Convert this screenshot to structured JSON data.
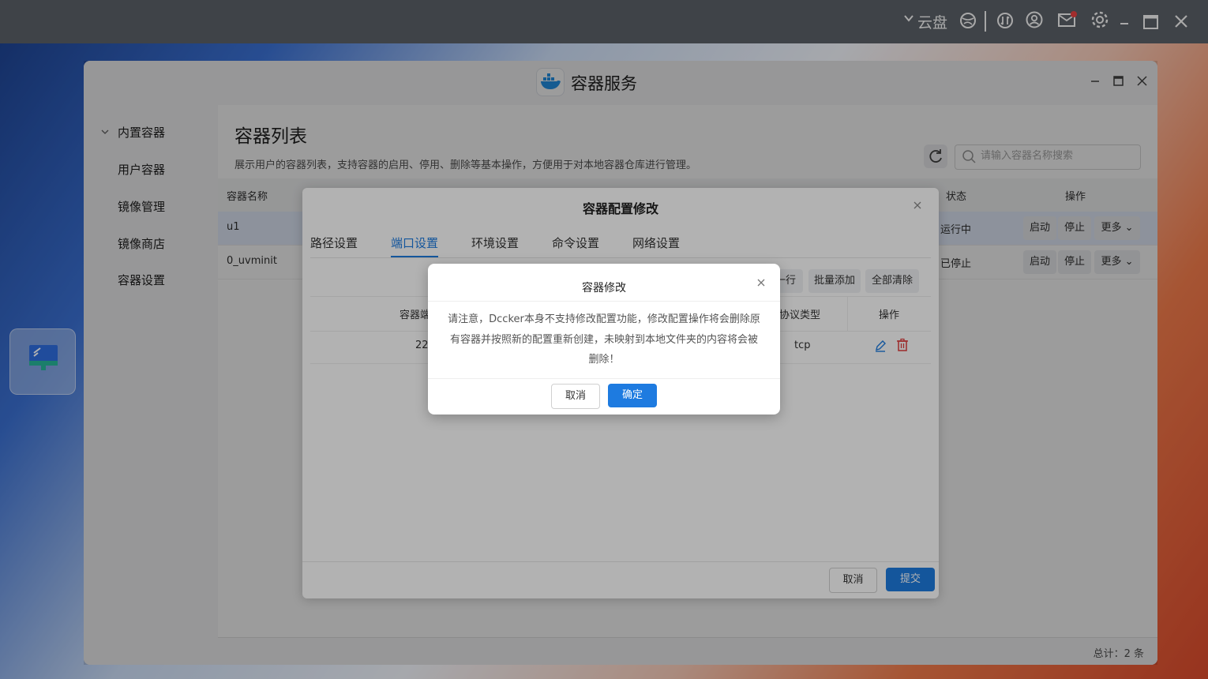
{
  "topbar": {
    "cloud_label": "云盘",
    "icons": [
      "chevron-down-icon",
      "globe-icon",
      "sync-icon",
      "user-icon",
      "mail-icon",
      "settings-icon",
      "minimize-icon",
      "maximize-icon",
      "close-icon"
    ]
  },
  "window": {
    "title": "容器服务",
    "logo_text": "docker"
  },
  "sidebar": {
    "group_label": "内置容器",
    "items": [
      {
        "label": "用户容器"
      },
      {
        "label": "镜像管理"
      },
      {
        "label": "镜像商店"
      },
      {
        "label": "容器设置"
      }
    ]
  },
  "main": {
    "title": "容器列表",
    "description": "展示用户的容器列表，支持容器的启用、停用、删除等基本操作，方便用于对本地容器仓库进行管理。",
    "search_placeholder": "请输入容器名称搜索",
    "columns": {
      "name": "容器名称",
      "status": "状态",
      "actions": "操作"
    },
    "rows": [
      {
        "name": "u1",
        "status": "运行中",
        "start": "启动",
        "stop": "停止",
        "more": "更多"
      },
      {
        "name": "0_uvminit",
        "status": "已停止",
        "start": "启动",
        "stop": "停止",
        "more": "更多"
      }
    ],
    "total": "总计：2 条"
  },
  "config_dialog": {
    "title": "容器配置修改",
    "tabs": [
      "路径设置",
      "端口设置",
      "环境设置",
      "命令设置",
      "网络设置"
    ],
    "active_tab": "端口设置",
    "toolbar": {
      "add_row_partial": "一行",
      "batch_add": "批量添加",
      "clear_all": "全部清除"
    },
    "columns": {
      "container_port_partial": "容器端",
      "protocol": "协议类型",
      "actions": "操作"
    },
    "row": {
      "port_partial": "22",
      "protocol": "tcp"
    },
    "cancel": "取消",
    "submit": "提交"
  },
  "confirm_dialog": {
    "title": "容器修改",
    "message": "请注意，Dccker本身不支持修改配置功能，修改配置操作将会删除原有容器并按照新的配置重新创建，未映射到本地文件夹的内容将会被删除！",
    "cancel": "取消",
    "ok": "确定"
  },
  "colors": {
    "accent": "#1e7be0",
    "topbar": "#5b6068",
    "selected_row": "#e6f0ff",
    "delete_icon": "#e03c3c"
  }
}
